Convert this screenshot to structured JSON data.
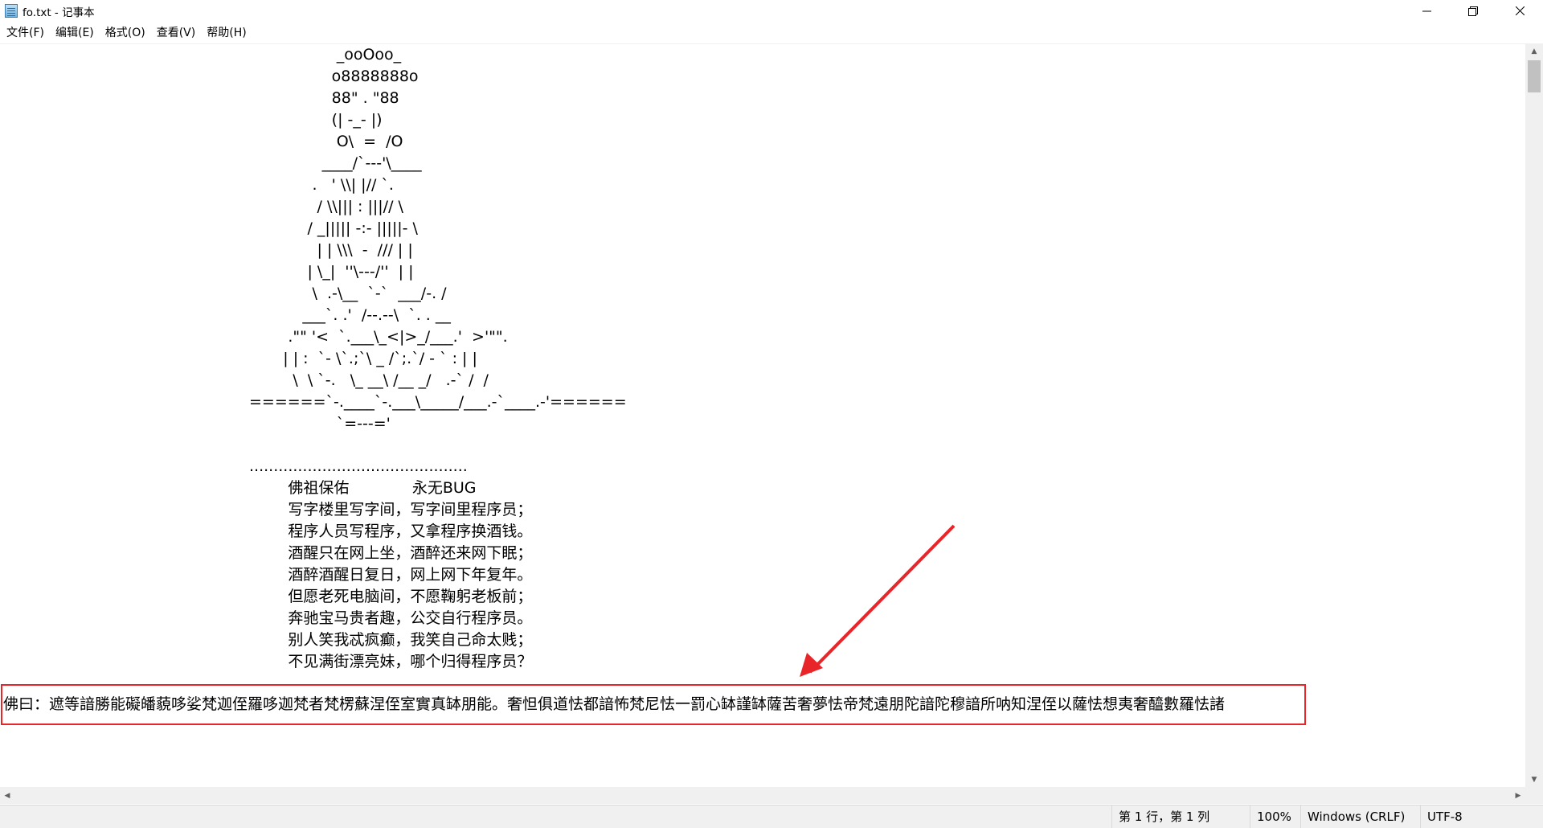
{
  "window": {
    "title": "fo.txt - 记事本",
    "minimize_icon": "minimize-icon",
    "maximize_icon": "restore-icon",
    "close_icon": "close-icon"
  },
  "menu": [
    "文件(F)",
    "编辑(E)",
    "格式(O)",
    "查看(V)",
    "帮助(H)"
  ],
  "document": {
    "art_lines": [
      "                  _ooOoo_",
      "                 o8888888o",
      "                 88\" . \"88",
      "                 (| -_- |)",
      "                  O\\  =  /O",
      "               ____/`---'\\____",
      "             .   ' \\\\| |// `.",
      "              / \\\\||| : |||// \\",
      "            / _||||| -:- |||||- \\",
      "              | | \\\\\\  -  /// | |",
      "            | \\_|  ''\\---/''  | |",
      "             \\  .-\\__  `-`  ___/-. /",
      "           ___`. .'  /--.--\\  `. . __",
      "        .\"\" '<  `.___\\_<|>_/___.'  >'\"\".",
      "       | | :  `- \\`.;`\\ _ /`;.`/ - ` : | |",
      "         \\  \\ `-.   \\_ __\\ /__ _/   .-` /  /",
      "======`-.____`-.___\\_____/___.-`____.-'======",
      "                  `=---='",
      "",
      "",
      ".............................................",
      "        佛祖保佑             永无BUG",
      "        写字楼里写字间，写字间里程序员；",
      "        程序人员写程序，又拿程序换酒钱。",
      "        酒醒只在网上坐，酒醉还来网下眠；",
      "        酒醉酒醒日复日，网上网下年复年。",
      "        但愿老死电脑间，不愿鞠躬老板前；",
      "        奔驰宝马贵者趣，公交自行程序员。",
      "        别人笑我忒疯癫，我笑自己命太贱；",
      "        不见满街漂亮妹，哪个归得程序员？"
    ],
    "highlighted_line": "佛曰：遮等諳勝能礙皤藐哆娑梵迦侄羅哆迦梵者梵楞蘇涅侄室實真缽朋能。奢怛俱道怯都諳怖梵尼怯一罰心缽謹缽薩苦奢夢怯帝梵遠朋陀諳陀穆諳所呐知涅侄以薩怯想夷奢醯數羅怯諸"
  },
  "status_bar": {
    "position": "第 1 行，第 1 列",
    "zoom": "100%",
    "line_ending": "Windows (CRLF)",
    "encoding": "UTF-8"
  },
  "annotation": {
    "color": "#e8262a"
  }
}
